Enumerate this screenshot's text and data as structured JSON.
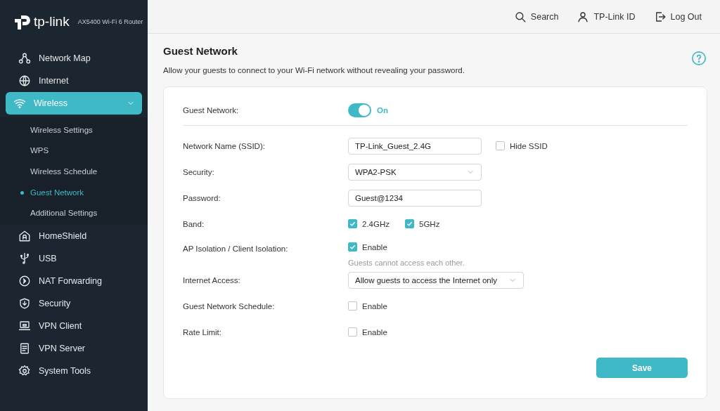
{
  "brand": {
    "logo_text": "tp-link",
    "model": "AX5400 Wi-Fi 6 Router"
  },
  "sidebar": {
    "items": [
      {
        "label": "Network Map",
        "selected": false
      },
      {
        "label": "Internet",
        "selected": false
      },
      {
        "label": "Wireless",
        "selected": true,
        "expanded": true,
        "children": [
          {
            "label": "Wireless Settings",
            "selected": false
          },
          {
            "label": "WPS",
            "selected": false
          },
          {
            "label": "Wireless Schedule",
            "selected": false
          },
          {
            "label": "Guest Network",
            "selected": true
          },
          {
            "label": "Additional Settings",
            "selected": false
          }
        ]
      },
      {
        "label": "HomeShield",
        "selected": false
      },
      {
        "label": "USB",
        "selected": false
      },
      {
        "label": "NAT Forwarding",
        "selected": false
      },
      {
        "label": "Security",
        "selected": false
      },
      {
        "label": "VPN Client",
        "selected": false
      },
      {
        "label": "VPN Server",
        "selected": false
      },
      {
        "label": "System Tools",
        "selected": false
      }
    ]
  },
  "header": {
    "actions": [
      {
        "label": "Search"
      },
      {
        "label": "TP-Link ID"
      },
      {
        "label": "Log Out"
      }
    ]
  },
  "page": {
    "title": "Guest Network",
    "description": "Allow your guests to connect to your Wi-Fi network without revealing your password."
  },
  "form": {
    "rows": [
      {
        "kind": "toggle",
        "label": "Guest Network:",
        "on": true,
        "state_text": "On"
      },
      {
        "kind": "text",
        "label": "Network Name (SSID):",
        "value": "TP-Link_Guest_2.4G",
        "extra": {
          "label": "Hide SSID",
          "checked": false
        }
      },
      {
        "kind": "select",
        "label": "Security:",
        "value": "WPA2-PSK"
      },
      {
        "kind": "text",
        "label": "Password:",
        "value": "Guest@1234"
      },
      {
        "kind": "checks",
        "label": "Band:",
        "options": [
          {
            "label": "2.4GHz",
            "checked": true
          },
          {
            "label": "5GHz",
            "checked": true
          }
        ]
      },
      {
        "kind": "checks",
        "label": "AP Isolation / Client Isolation:",
        "options": [
          {
            "label": "Enable",
            "checked": true
          }
        ],
        "note": "Guests cannot access each other."
      },
      {
        "kind": "select",
        "label": "Internet Access:",
        "value": "Allow guests to access the Internet only"
      },
      {
        "kind": "checks",
        "label": "Guest Network Schedule:",
        "options": [
          {
            "label": "Enable",
            "checked": false
          }
        ]
      },
      {
        "kind": "checks",
        "label": "Rate Limit:",
        "options": [
          {
            "label": "Enable",
            "checked": false
          }
        ]
      }
    ],
    "save": "Save"
  }
}
